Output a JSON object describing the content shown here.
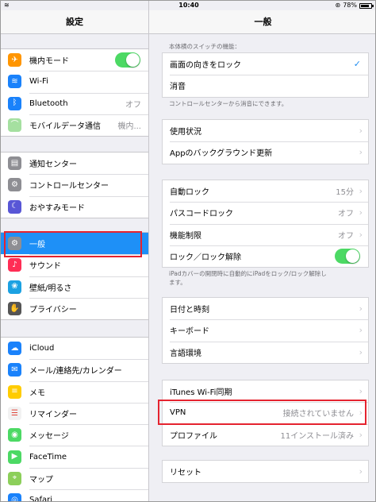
{
  "status_bar": {
    "time": "10:40",
    "battery": "78%",
    "battery_level": 0.78,
    "wifi_icon": "wifi-icon",
    "lock_icon": "orientation-lock-icon"
  },
  "left": {
    "title": "設定",
    "group1": [
      {
        "label": "機内モード",
        "icon": "airplane-icon",
        "color": "#ff9500",
        "glyph": "✈",
        "toggle": true
      },
      {
        "label": "Wi-Fi",
        "icon": "wifi-icon",
        "color": "#1a82fb",
        "glyph": "≋"
      },
      {
        "label": "Bluetooth",
        "icon": "bluetooth-icon",
        "color": "#1a82fb",
        "glyph": "ᛒ",
        "value": "オフ"
      },
      {
        "label": "モバイルデータ通信",
        "icon": "cellular-icon",
        "color": "#a5e0a0",
        "glyph": "⌒",
        "value": "機内..."
      }
    ],
    "group2": [
      {
        "label": "通知センター",
        "icon": "notification-center-icon",
        "color": "#8e8e93",
        "glyph": "▤"
      },
      {
        "label": "コントロールセンター",
        "icon": "control-center-icon",
        "color": "#8e8e93",
        "glyph": "⚙"
      },
      {
        "label": "おやすみモード",
        "icon": "moon-icon",
        "color": "#5856d6",
        "glyph": "☾"
      }
    ],
    "group3": [
      {
        "label": "一般",
        "icon": "gear-icon",
        "color": "#8e8e93",
        "glyph": "⚙",
        "selected": true
      },
      {
        "label": "サウンド",
        "icon": "speaker-icon",
        "color": "#ff2d55",
        "glyph": "♪"
      },
      {
        "label": "壁紙/明るさ",
        "icon": "flower-icon",
        "color": "#1ba1e2",
        "glyph": "❀"
      },
      {
        "label": "プライバシー",
        "icon": "hand-icon",
        "color": "#555555",
        "glyph": "✋"
      }
    ],
    "group4": [
      {
        "label": "iCloud",
        "icon": "icloud-icon",
        "color": "#1a82fb",
        "glyph": "☁"
      },
      {
        "label": "メール/連絡先/カレンダー",
        "icon": "mail-icon",
        "color": "#1a82fb",
        "glyph": "✉"
      },
      {
        "label": "メモ",
        "icon": "notes-icon",
        "color": "#ffcc00",
        "glyph": "≡"
      },
      {
        "label": "リマインダー",
        "icon": "reminders-icon",
        "color": "#f2f2f2",
        "glyph": "☰",
        "dark": true
      },
      {
        "label": "メッセージ",
        "icon": "messages-icon",
        "color": "#4cd964",
        "glyph": "◉"
      },
      {
        "label": "FaceTime",
        "icon": "facetime-icon",
        "color": "#4cd964",
        "glyph": "▶"
      },
      {
        "label": "マップ",
        "icon": "maps-icon",
        "color": "#8ccf5a",
        "glyph": "⌖"
      },
      {
        "label": "Safari",
        "icon": "safari-icon",
        "color": "#1a82fb",
        "glyph": "◎"
      }
    ]
  },
  "right": {
    "title": "一般",
    "side_switch_header": "本体横のスイッチの機能：",
    "side_switch": [
      {
        "label": "画面の向きをロック",
        "checked": true
      },
      {
        "label": "消音"
      }
    ],
    "side_switch_note": "コントロールセンターから消音にできます。",
    "group_usage": [
      {
        "label": "使用状況"
      },
      {
        "label": "Appのバックグラウンド更新"
      }
    ],
    "group_lock": [
      {
        "label": "自動ロック",
        "value": "15分"
      },
      {
        "label": "パスコードロック",
        "value": "オフ"
      },
      {
        "label": "機能制限",
        "value": "オフ"
      },
      {
        "label": "ロック／ロック解除",
        "toggle": true
      }
    ],
    "lock_note_1": "iPadカバーの開閉時に自動的にiPadをロック/ロック解除し",
    "lock_note_2": "ます。",
    "group_datetime": [
      {
        "label": "日付と時刻"
      },
      {
        "label": "キーボード"
      },
      {
        "label": "言語環境"
      }
    ],
    "group_vpn": [
      {
        "label": "iTunes Wi-Fi同期"
      },
      {
        "label": "VPN",
        "value": "接続されていません"
      },
      {
        "label": "プロファイル",
        "value": "11インストール済み"
      }
    ],
    "group_reset": [
      {
        "label": "リセット"
      }
    ]
  },
  "colors": {
    "accent": "#1e90f7",
    "highlight_box": "#e5232f",
    "toggle_on": "#4cd964"
  }
}
